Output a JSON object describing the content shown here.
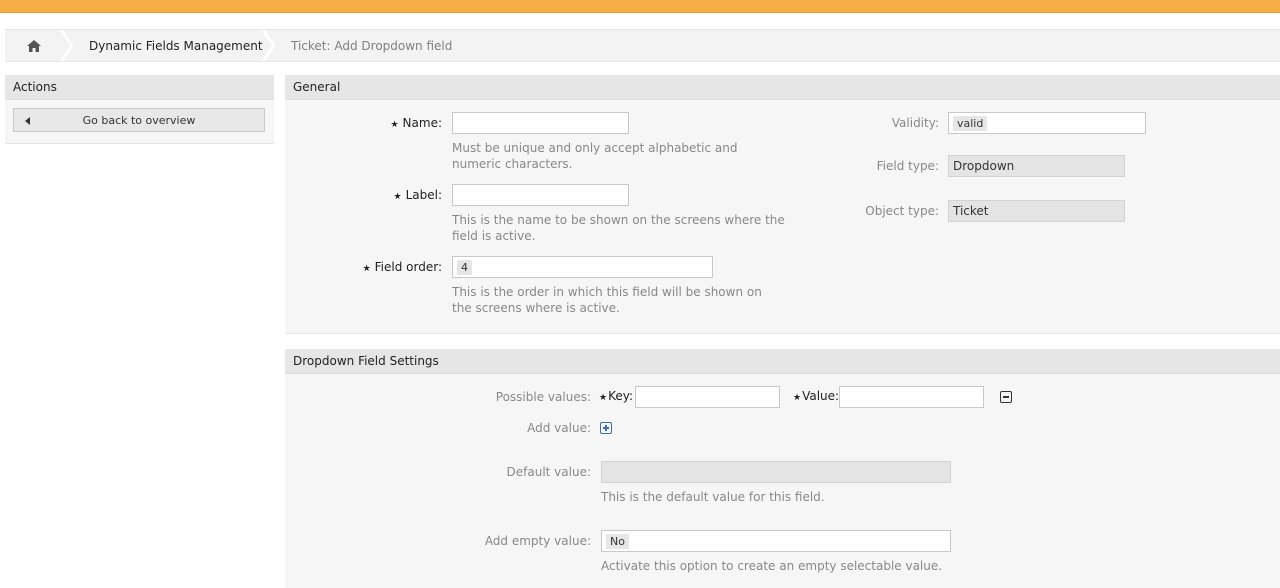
{
  "breadcrumb": {
    "home_icon": "home-icon",
    "items": [
      "Dynamic Fields Management",
      "Ticket: Add Dropdown field"
    ]
  },
  "sidebar": {
    "title": "Actions",
    "back_button": "Go back to overview"
  },
  "general": {
    "title": "General",
    "name": {
      "label": "Name:",
      "value": "",
      "hint": "Must be unique and only accept alphabetic and numeric characters."
    },
    "label_field": {
      "label": "Label:",
      "value": "",
      "hint": "This is the name to be shown on the screens where the field is active."
    },
    "field_order": {
      "label": "Field order:",
      "value": "4",
      "hint": "This is the order in which this field will be shown on the screens where is active."
    },
    "validity": {
      "label": "Validity:",
      "value": "valid"
    },
    "field_type": {
      "label": "Field type:",
      "value": "Dropdown"
    },
    "object_type": {
      "label": "Object type:",
      "value": "Ticket"
    }
  },
  "dropdown": {
    "title": "Dropdown Field Settings",
    "possible_values": {
      "label": "Possible values:",
      "key_label": "Key:",
      "key_value": "",
      "value_label": "Value:",
      "value_value": ""
    },
    "add_value": {
      "label": "Add value:"
    },
    "default_value": {
      "label": "Default value:",
      "value": "",
      "hint": "This is the default value for this field."
    },
    "add_empty_value": {
      "label": "Add empty value:",
      "value": "No",
      "hint": "Activate this option to create an empty selectable value."
    }
  },
  "colors": {
    "topbar": "#f6ae45",
    "panel_bg": "#f6f6f6",
    "header_bg": "#e6e6e6"
  }
}
